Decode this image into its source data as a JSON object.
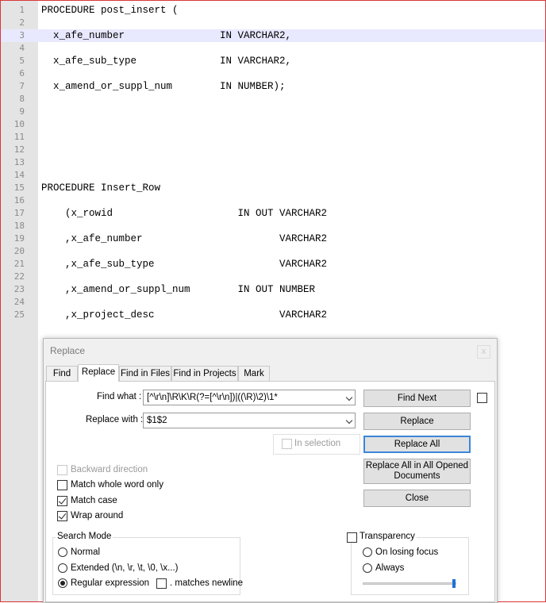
{
  "editor": {
    "lines": [
      {
        "num": "1",
        "text": "PROCEDURE post_insert ("
      },
      {
        "num": "2",
        "text": ""
      },
      {
        "num": "3",
        "text": "  x_afe_number                IN VARCHAR2,"
      },
      {
        "num": "4",
        "text": ""
      },
      {
        "num": "5",
        "text": "  x_afe_sub_type              IN VARCHAR2,"
      },
      {
        "num": "6",
        "text": ""
      },
      {
        "num": "7",
        "text": "  x_amend_or_suppl_num        IN NUMBER);"
      },
      {
        "num": "8",
        "text": ""
      },
      {
        "num": "9",
        "text": ""
      },
      {
        "num": "10",
        "text": ""
      },
      {
        "num": "11",
        "text": ""
      },
      {
        "num": "12",
        "text": ""
      },
      {
        "num": "13",
        "text": ""
      },
      {
        "num": "14",
        "text": ""
      },
      {
        "num": "15",
        "text": "PROCEDURE Insert_Row"
      },
      {
        "num": "16",
        "text": ""
      },
      {
        "num": "17",
        "text": "    (x_rowid                     IN OUT VARCHAR2"
      },
      {
        "num": "18",
        "text": ""
      },
      {
        "num": "19",
        "text": "    ,x_afe_number                       VARCHAR2"
      },
      {
        "num": "20",
        "text": ""
      },
      {
        "num": "21",
        "text": "    ,x_afe_sub_type                     VARCHAR2"
      },
      {
        "num": "22",
        "text": ""
      },
      {
        "num": "23",
        "text": "    ,x_amend_or_suppl_num        IN OUT NUMBER"
      },
      {
        "num": "24",
        "text": ""
      },
      {
        "num": "25",
        "text": "    ,x_project_desc                     VARCHAR2"
      }
    ]
  },
  "dialog": {
    "title": "Replace",
    "close_label": "x",
    "tabs": [
      "Find",
      "Replace",
      "Find in Files",
      "Find in Projects",
      "Mark"
    ],
    "find_what_label": "Find what :",
    "find_what_value": "[^\\r\\n]\\R\\K\\R(?=[^\\r\\n])|((\\R)\\2)\\1*",
    "replace_with_label": "Replace with :",
    "replace_with_value": "$1$2",
    "in_selection_label": "In selection",
    "backward_direction_label": "Backward direction",
    "match_whole_word_label": "Match whole word only",
    "match_case_label": "Match case",
    "wrap_around_label": "Wrap around",
    "search_mode": {
      "title": "Search Mode",
      "normal_label": "Normal",
      "extended_label": "Extended (\\n, \\r, \\t, \\0, \\x...)",
      "regex_label": "Regular expression",
      "matches_newline_label": ". matches newline",
      "selected": "Regular expression"
    },
    "buttons": {
      "find_next": "Find Next",
      "replace": "Replace",
      "replace_all": "Replace All",
      "replace_all_opened": "Replace All in All Opened Documents",
      "close": "Close"
    },
    "transparency": {
      "title": "Transparency",
      "on_losing_focus_label": "On losing focus",
      "always_label": "Always",
      "level": 1.0
    },
    "checked": {
      "backward_direction": false,
      "match_whole_word": false,
      "match_case": true,
      "wrap_around": true,
      "matches_newline": false,
      "in_selection": false,
      "transparency": false,
      "find_next_extra": false
    }
  }
}
